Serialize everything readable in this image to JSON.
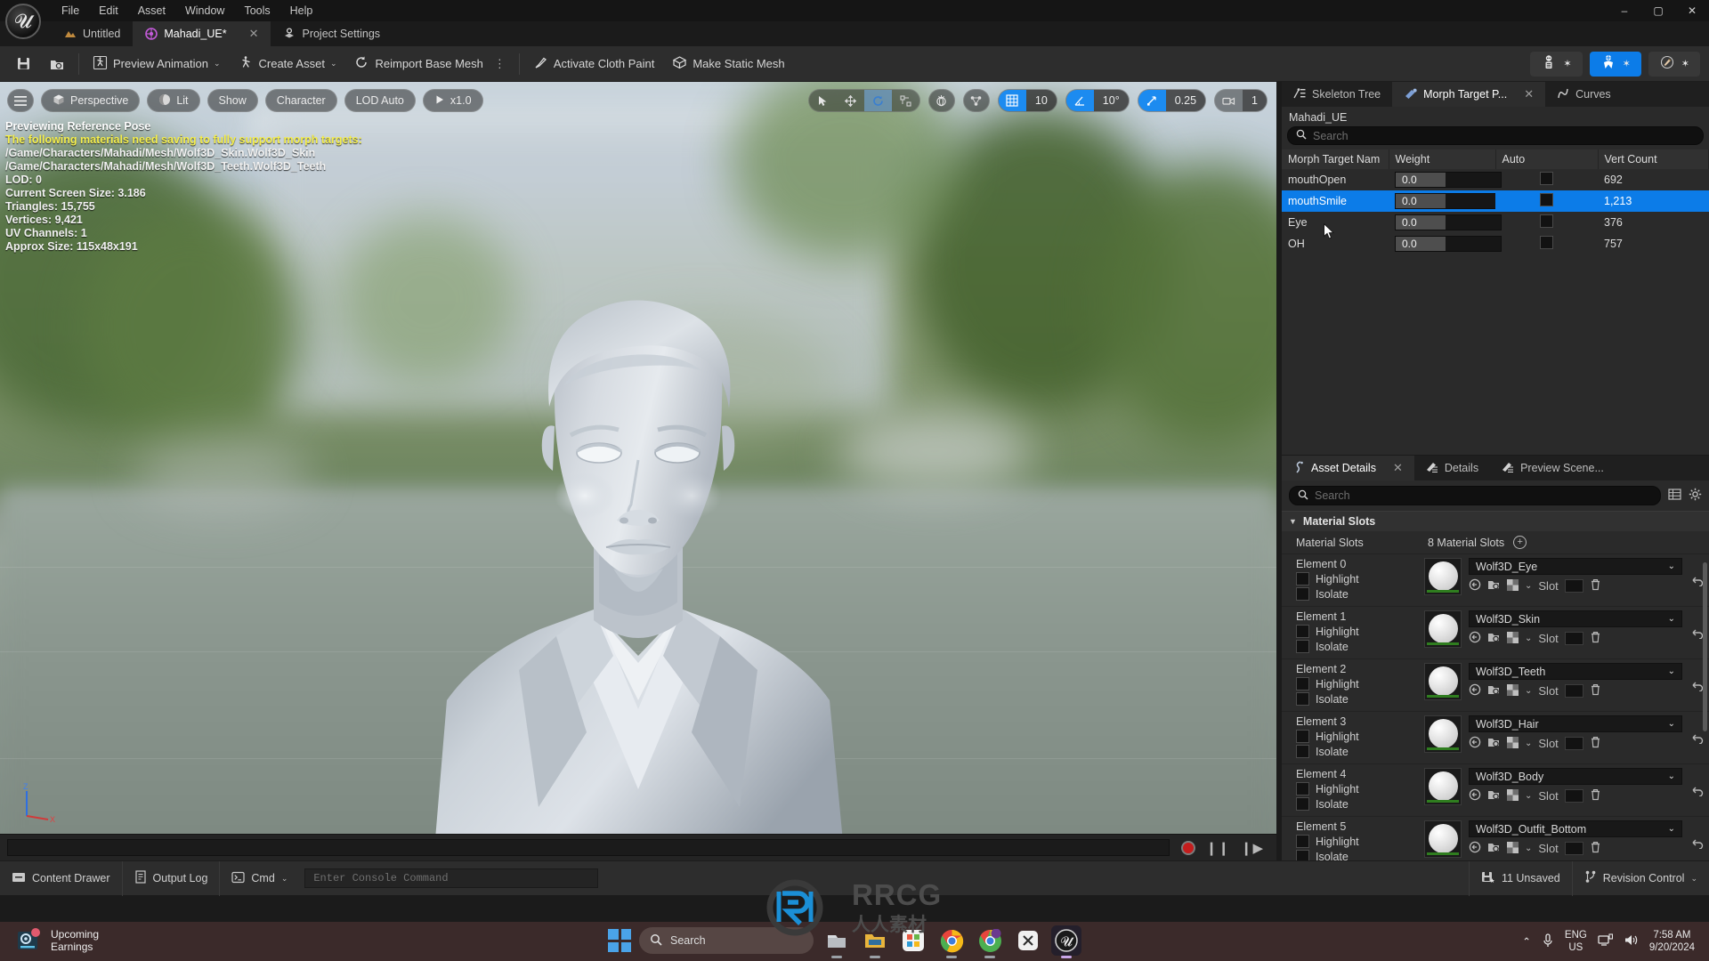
{
  "menu": {
    "items": [
      "File",
      "Edit",
      "Asset",
      "Window",
      "Tools",
      "Help"
    ],
    "logo": "ue-logo"
  },
  "window_controls": {
    "minimize": "–",
    "maximize": "▢",
    "close": "✕"
  },
  "tabs": [
    {
      "label": "Untitled",
      "icon": "level-icon",
      "active": false,
      "closable": false
    },
    {
      "label": "Mahadi_UE*",
      "icon": "skeletal-mesh-icon",
      "active": true,
      "closable": true,
      "close": "✕"
    },
    {
      "label": "Project Settings",
      "icon": "settings-icon",
      "active": false,
      "closable": false
    }
  ],
  "toolbar": {
    "save_label": "Save",
    "browse_label": "Browse",
    "items": [
      {
        "label": "Preview Animation",
        "icon": "preview-animation-icon",
        "dropdown": "⌄"
      },
      {
        "label": "Create Asset",
        "icon": "create-asset-icon",
        "dropdown": "⌄"
      },
      {
        "label": "Reimport Base Mesh",
        "icon": "reimport-icon",
        "overflow": "⋮"
      },
      {
        "label": "Activate Cloth Paint",
        "icon": "cloth-paint-icon"
      },
      {
        "label": "Make Static Mesh",
        "icon": "static-mesh-icon"
      }
    ],
    "right_modes": [
      {
        "name": "skeleton-mode",
        "icon": "skeleton-icon",
        "star": "✶",
        "active": false
      },
      {
        "name": "skeletal-mesh-mode",
        "icon": "skeletal-mesh-mode-icon",
        "star": "✶",
        "active": true
      },
      {
        "name": "animation-mode",
        "icon": "animation-icon",
        "star": "✶",
        "active": false
      }
    ]
  },
  "viewport": {
    "left_controls": [
      {
        "name": "viewport-menu",
        "label": "",
        "icon": "hamburger-icon"
      },
      {
        "name": "camera-mode",
        "label": "Perspective",
        "icon": "cube-icon"
      },
      {
        "name": "view-mode",
        "label": "Lit",
        "icon": "sphere-icon"
      },
      {
        "name": "show-menu",
        "label": "Show",
        "icon": ""
      },
      {
        "name": "character-menu",
        "label": "Character",
        "icon": ""
      },
      {
        "name": "lod-menu",
        "label": "LOD Auto",
        "icon": ""
      },
      {
        "name": "playback-speed",
        "label": "x1.0",
        "icon": "play-icon"
      }
    ],
    "right_controls": {
      "transform_tools": [
        "select-icon",
        "move-icon",
        "rotate-icon",
        "scale-icon"
      ],
      "coord_space_icon": "world-space-icon",
      "pivot_icon": "pivot-icon",
      "grid_snap_value": "10",
      "angle_snap_value": "10°",
      "scale_snap_value": "0.25",
      "camera_speed_value": "1"
    },
    "stats": {
      "preview_mode": "Previewing Reference Pose",
      "warning": "The following materials need saving to fully support morph targets:",
      "material_paths": [
        "/Game/Characters/Mahadi/Mesh/Wolf3D_Skin.Wolf3D_Skin",
        "/Game/Characters/Mahadi/Mesh/Wolf3D_Teeth.Wolf3D_Teeth"
      ],
      "lines": [
        "LOD: 0",
        "Current Screen Size: 3.186",
        "Triangles: 15,755",
        "Vertices: 9,421",
        "UV Channels: 1",
        "Approx Size: 115x48x191"
      ]
    },
    "axis_labels": {
      "z": "Z",
      "x": "X"
    },
    "transport": {
      "record": "record-icon",
      "pause": "pause-icon",
      "step": "step-forward-icon"
    }
  },
  "morph_panel": {
    "tabs": [
      {
        "label": "Skeleton Tree",
        "icon": "skeleton-tree-icon",
        "active": false
      },
      {
        "label": "Morph Target P...",
        "icon": "morph-target-icon",
        "active": true,
        "close": "✕"
      },
      {
        "label": "Curves",
        "icon": "curves-icon",
        "active": false
      }
    ],
    "asset_name": "Mahadi_UE",
    "search_placeholder": "Search",
    "columns": [
      "Morph Target Nam",
      "Weight",
      "Auto",
      "Vert Count"
    ],
    "rows": [
      {
        "name": "mouthOpen",
        "weight": "0.0",
        "auto": false,
        "vert_count": "692",
        "selected": false
      },
      {
        "name": "mouthSmile",
        "weight": "0.0",
        "auto": false,
        "vert_count": "1,213",
        "selected": true
      },
      {
        "name": "Eye",
        "weight": "0.0",
        "auto": false,
        "vert_count": "376",
        "selected": false
      },
      {
        "name": "OH",
        "weight": "0.0",
        "auto": false,
        "vert_count": "757",
        "selected": false
      }
    ]
  },
  "asset_details": {
    "tabs": [
      {
        "label": "Asset Details",
        "icon": "asset-details-icon",
        "active": true,
        "close": "✕"
      },
      {
        "label": "Details",
        "icon": "details-icon",
        "active": false
      },
      {
        "label": "Preview Scene...",
        "icon": "preview-scene-icon",
        "active": false
      }
    ],
    "search_placeholder": "Search",
    "section_title": "Material Slots",
    "slots_row": {
      "label": "Material Slots",
      "value": "8 Material Slots",
      "add_icon": "plus-circle-icon"
    },
    "slot_label": "Slot",
    "highlight_label": "Highlight",
    "isolate_label": "Isolate",
    "elements": [
      {
        "label": "Element 0",
        "material": "Wolf3D_Eye",
        "highlight": false,
        "isolate": false
      },
      {
        "label": "Element 1",
        "material": "Wolf3D_Skin",
        "highlight": false,
        "isolate": false
      },
      {
        "label": "Element 2",
        "material": "Wolf3D_Teeth",
        "highlight": false,
        "isolate": false
      },
      {
        "label": "Element 3",
        "material": "Wolf3D_Hair",
        "highlight": false,
        "isolate": false
      },
      {
        "label": "Element 4",
        "material": "Wolf3D_Body",
        "highlight": false,
        "isolate": false
      },
      {
        "label": "Element 5",
        "material": "Wolf3D_Outfit_Bottom",
        "highlight": false,
        "isolate": false
      }
    ]
  },
  "status_bar": {
    "left": [
      {
        "label": "Content Drawer",
        "icon": "content-drawer-icon"
      },
      {
        "label": "Output Log",
        "icon": "output-log-icon"
      },
      {
        "label": "Cmd",
        "icon": "cmd-icon",
        "dropdown": "⌄"
      }
    ],
    "console_placeholder": "Enter Console Command",
    "right": [
      {
        "label": "11 Unsaved",
        "icon": "unsaved-icon"
      },
      {
        "label": "Revision Control",
        "icon": "revision-control-icon",
        "dropdown": "⌄"
      }
    ]
  },
  "watermark": {
    "text": "RRCG",
    "subtext": "人人素材"
  },
  "taskbar": {
    "weather": {
      "line1": "Upcoming",
      "line2": "Earnings",
      "icon": "weather-icon"
    },
    "search_placeholder": "Search",
    "start_icon": "windows-start-icon",
    "apps": [
      {
        "name": "file-explorer-icon",
        "running": true
      },
      {
        "name": "folder-icon",
        "running": true
      },
      {
        "name": "microsoft-store-icon",
        "running": false
      },
      {
        "name": "chrome-icon",
        "running": true
      },
      {
        "name": "chrome-profile-icon",
        "running": true
      },
      {
        "name": "app-icon",
        "running": false
      },
      {
        "name": "unreal-engine-icon",
        "running": true
      }
    ],
    "tray": {
      "chevron": "⌃",
      "mic_icon": "microphone-icon",
      "lang_line1": "ENG",
      "lang_line2": "US",
      "network_icon": "network-icon",
      "volume_icon": "volume-icon",
      "time": "7:58 AM",
      "date": "9/20/2024"
    }
  },
  "colors": {
    "accent_blue": "#0c7ce8",
    "panel_bg": "#2a2a2a",
    "toolbar_bg": "#2d2d2d",
    "warning_yellow": "#f5ef4d",
    "record_red": "#c41d1d"
  }
}
